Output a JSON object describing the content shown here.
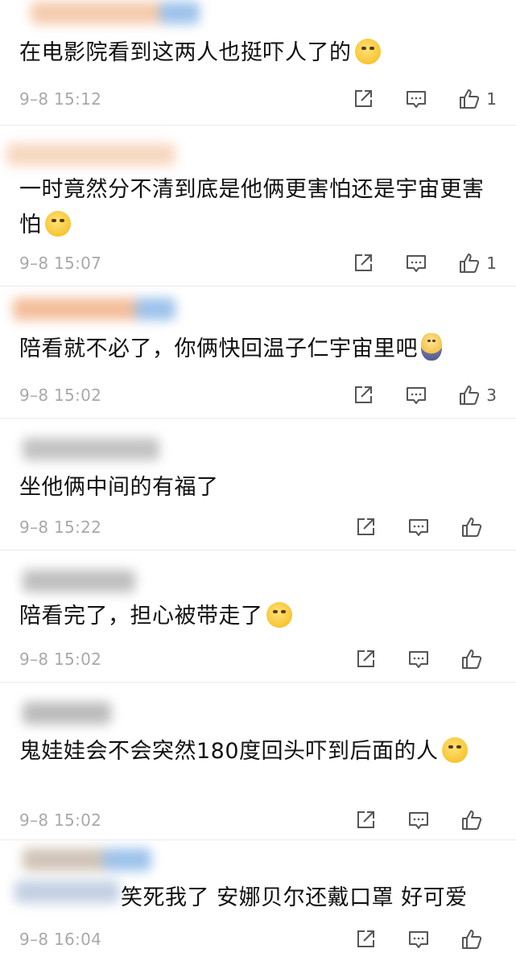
{
  "comments": [
    {
      "text": "在电影院看到这两人也挺吓人了的",
      "emoji": "laugh-cry-emoji",
      "time": "9–8 15:12",
      "likes": "1"
    },
    {
      "text": "一时竟然分不清到底是他俩更害怕还是宇宙更害怕",
      "emoji": "thinking-emoji",
      "time": "9–8 15:07",
      "likes": "1"
    },
    {
      "text": "陪看就不必了，你俩快回温子仁宇宙里吧",
      "emoji": "doll-emoji",
      "time": "9–8 15:02",
      "likes": "3"
    },
    {
      "text": "坐他俩中间的有福了",
      "emoji": "",
      "time": "9–8 15:22",
      "likes": ""
    },
    {
      "text": "陪看完了，担心被带走了",
      "emoji": "doge-emoji",
      "time": "9–8 15:02",
      "likes": ""
    },
    {
      "text": "鬼娃娃会不会突然180度回头吓到后面的人",
      "emoji": "laugh-cry-emoji",
      "time": "9–8 15:02",
      "likes": ""
    },
    {
      "text": "笑死我了 安娜贝尔还戴口罩 好可爱",
      "emoji": "",
      "time": "9–8 16:04",
      "likes": ""
    }
  ],
  "colors": {
    "blur_orange": "#f3b58a",
    "blur_blue": "#8db8e8",
    "blur_gray": "#9a9a9a",
    "divider": "#ebebeb",
    "time": "#a9a9a9"
  }
}
